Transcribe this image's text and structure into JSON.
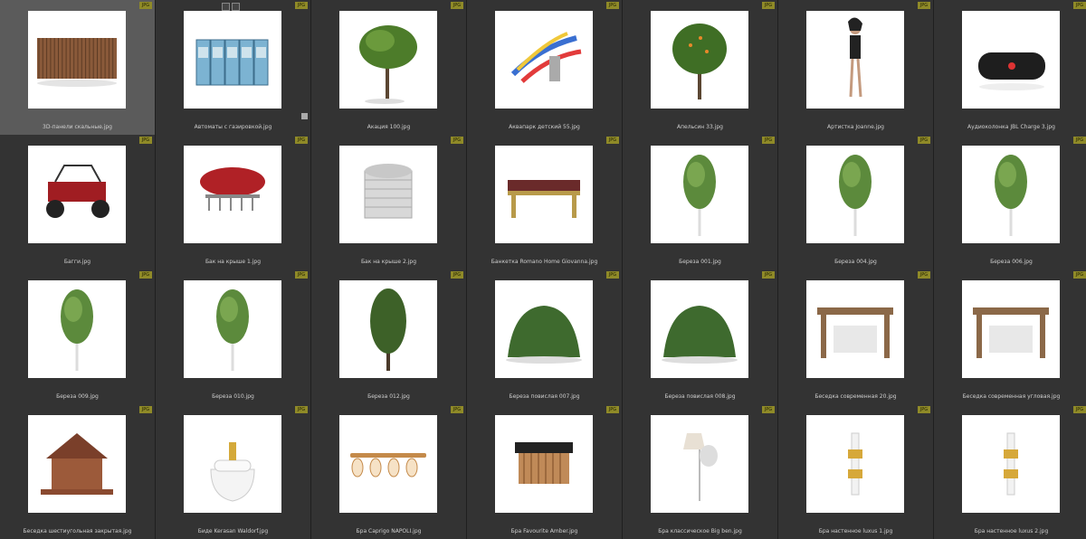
{
  "badge_label": "JPG",
  "items": [
    {
      "name": "3D-панели скальные.jpg",
      "icon": "wood-panel-icon",
      "selected": true
    },
    {
      "name": "Автоматы с газировкой.jpg",
      "icon": "vending-machine-icon",
      "selected": false,
      "toolbar": true
    },
    {
      "name": "Акация 100.jpg",
      "icon": "tree-icon"
    },
    {
      "name": "Аквапарк детский 55.jpg",
      "icon": "water-slide-icon"
    },
    {
      "name": "Апельсин 33.jpg",
      "icon": "orange-tree-icon"
    },
    {
      "name": "Артистка Joanne.jpg",
      "icon": "woman-figure-icon"
    },
    {
      "name": "Аудиоколонка JBL Charge 3.jpg",
      "icon": "speaker-icon"
    },
    {
      "name": "Багги.jpg",
      "icon": "buggy-icon"
    },
    {
      "name": "Бак на крыше 1.jpg",
      "icon": "tank-icon"
    },
    {
      "name": "Бак на крыше 2.jpg",
      "icon": "silo-tank-icon"
    },
    {
      "name": "Банкетка Romano Home Giovanna.jpg",
      "icon": "bench-icon"
    },
    {
      "name": "Береза 001.jpg",
      "icon": "birch-icon"
    },
    {
      "name": "Береза 004.jpg",
      "icon": "birch-icon"
    },
    {
      "name": "Береза 006.jpg",
      "icon": "birch-icon"
    },
    {
      "name": "Береза 009.jpg",
      "icon": "birch-icon"
    },
    {
      "name": "Береза 010.jpg",
      "icon": "birch-icon"
    },
    {
      "name": "Береза 012.jpg",
      "icon": "willow-icon"
    },
    {
      "name": "Береза повислая 007.jpg",
      "icon": "weeping-birch-icon"
    },
    {
      "name": "Береза повислая 008.jpg",
      "icon": "weeping-birch-icon"
    },
    {
      "name": "Беседка современная 20.jpg",
      "icon": "pavilion-icon"
    },
    {
      "name": "Беседка современная угловая.jpg",
      "icon": "pavilion-icon"
    },
    {
      "name": "Беседка шестиугольная закрытая.jpg",
      "icon": "gazebo-icon"
    },
    {
      "name": "Биде Kerasan Waldorf.jpg",
      "icon": "bidet-icon"
    },
    {
      "name": "Бра Caprigo NAPOLI.jpg",
      "icon": "wall-lamp-icon"
    },
    {
      "name": "Бра Favourite Amber.jpg",
      "icon": "sconce-icon"
    },
    {
      "name": "Бра классическое Big ben.jpg",
      "icon": "lamp-icon"
    },
    {
      "name": "Бра настенное luxus 1.jpg",
      "icon": "wall-light-icon"
    },
    {
      "name": "Бра настенное luxus 2.jpg",
      "icon": "wall-light-icon"
    }
  ]
}
